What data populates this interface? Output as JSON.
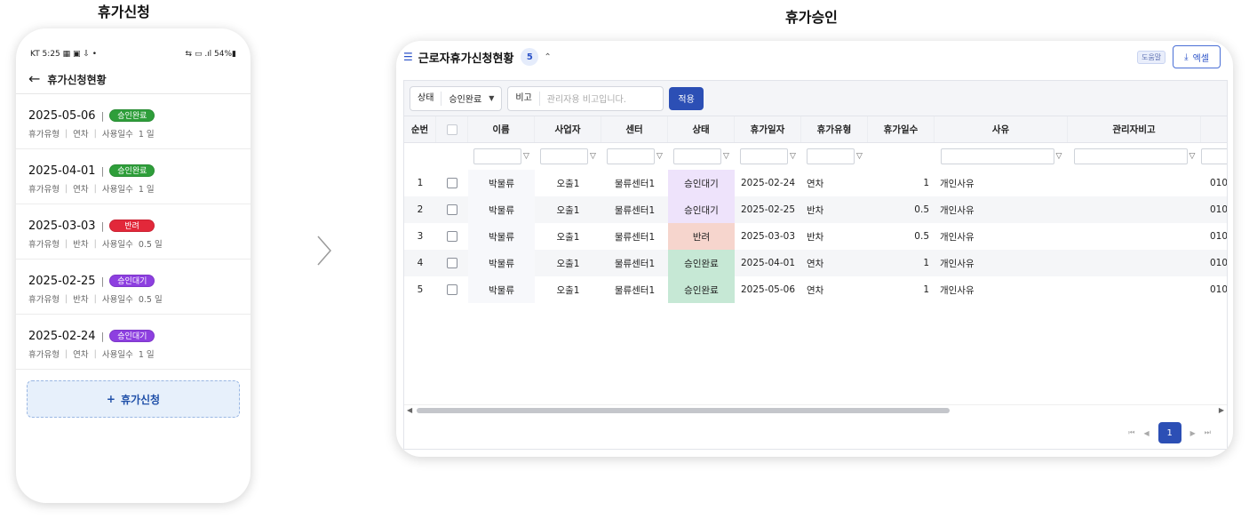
{
  "left_title": "휴가신청",
  "right_title": "휴가승인",
  "phone": {
    "status_left": "KT 5:25 ▦ ▣ ⇩ •",
    "status_right": "⇆ ▭ .ıl 54%▮",
    "title": "휴가신청현황",
    "items": [
      {
        "date": "2025-05-06",
        "status": "승인완료",
        "status_color": "#2e9e3a",
        "type_label": "휴가유형",
        "type": "연차",
        "days_label": "사용일수",
        "days": "1 일"
      },
      {
        "date": "2025-04-01",
        "status": "승인완료",
        "status_color": "#2e9e3a",
        "type_label": "휴가유형",
        "type": "연차",
        "days_label": "사용일수",
        "days": "1 일"
      },
      {
        "date": "2025-03-03",
        "status": "반려",
        "status_color": "#e2283a",
        "type_label": "휴가유형",
        "type": "반차",
        "days_label": "사용일수",
        "days": "0.5 일"
      },
      {
        "date": "2025-02-25",
        "status": "승인대기",
        "status_color": "#8d3fe0",
        "type_label": "휴가유형",
        "type": "반차",
        "days_label": "사용일수",
        "days": "0.5 일"
      },
      {
        "date": "2025-02-24",
        "status": "승인대기",
        "status_color": "#8d3fe0",
        "type_label": "휴가유형",
        "type": "연차",
        "days_label": "사용일수",
        "days": "1 일"
      }
    ],
    "apply_button": "휴가신청"
  },
  "desktop": {
    "title": "근로자휴가신청현황",
    "count": "5",
    "help": "도움말",
    "excel": "엑셀",
    "filter_status_label": "상태",
    "filter_status_value": "승인완료",
    "filter_note_label": "비고",
    "filter_note_placeholder": "관리자용 비고입니다.",
    "apply_button": "적용",
    "columns": [
      "순번",
      "",
      "이름",
      "사업자",
      "센터",
      "상태",
      "휴가일자",
      "휴가유형",
      "휴가일수",
      "사유",
      "관리자비고",
      ""
    ],
    "rows": [
      {
        "no": "1",
        "name": "박물류",
        "company": "오출1",
        "center": "물류센터1",
        "status": "승인대기",
        "date": "2025-02-24",
        "type": "연차",
        "days": "1",
        "reason": "개인사유",
        "phone": "010"
      },
      {
        "no": "2",
        "name": "박물류",
        "company": "오출1",
        "center": "물류센터1",
        "status": "승인대기",
        "date": "2025-02-25",
        "type": "반차",
        "days": "0.5",
        "reason": "개인사유",
        "phone": "010"
      },
      {
        "no": "3",
        "name": "박물류",
        "company": "오출1",
        "center": "물류센터1",
        "status": "반려",
        "date": "2025-03-03",
        "type": "반차",
        "days": "0.5",
        "reason": "개인사유",
        "phone": "010"
      },
      {
        "no": "4",
        "name": "박물류",
        "company": "오출1",
        "center": "물류센터1",
        "status": "승인완료",
        "date": "2025-04-01",
        "type": "연차",
        "days": "1",
        "reason": "개인사유",
        "phone": "010"
      },
      {
        "no": "5",
        "name": "박물류",
        "company": "오출1",
        "center": "물류센터1",
        "status": "승인완료",
        "date": "2025-05-06",
        "type": "연차",
        "days": "1",
        "reason": "개인사유",
        "phone": "010"
      }
    ],
    "current_page": "1"
  }
}
